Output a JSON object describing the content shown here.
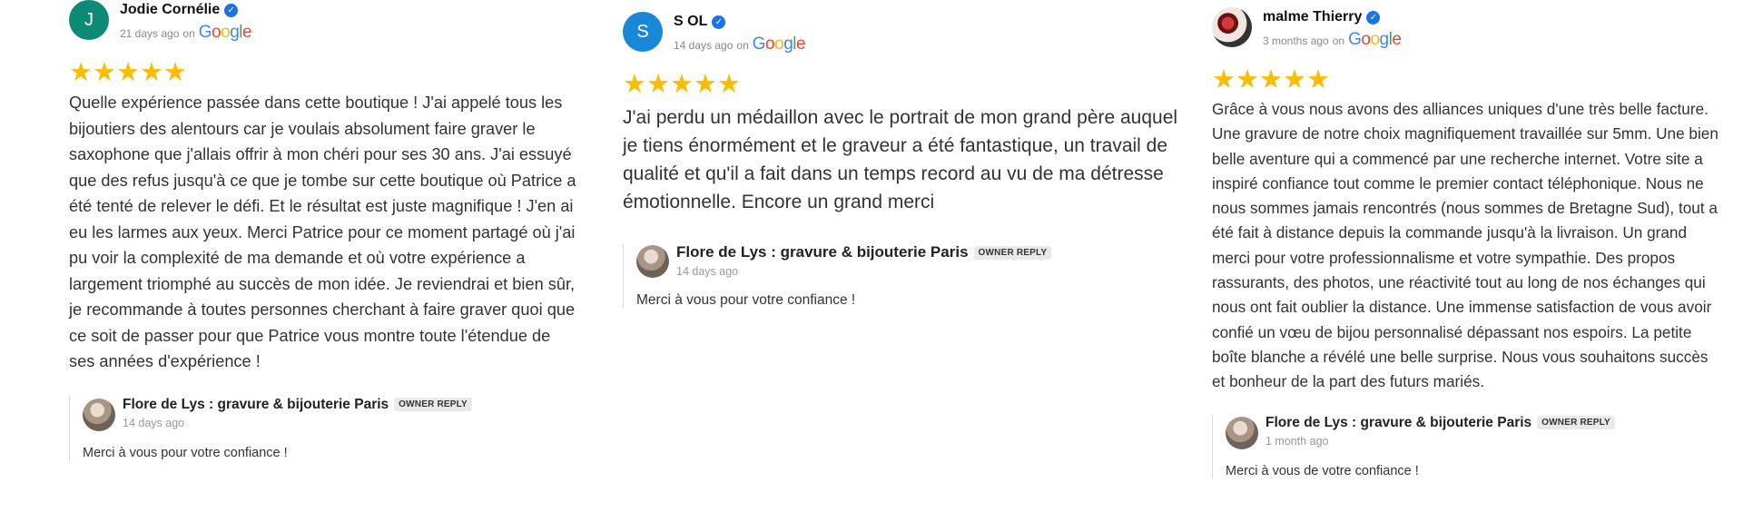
{
  "reviews": [
    {
      "avatar_letter": "J",
      "author": "Jodie Cornélie",
      "time": "21 days ago",
      "source_prefix": "on",
      "stars": "★★★★★",
      "text": "Quelle expérience passée dans cette boutique ! J'ai appelé tous les bijoutiers des alentours car je voulais absolument faire graver le saxophone que j'allais offrir à mon chéri pour ses 30 ans. J'ai essuyé que des refus jusqu'à ce que je tombe sur cette boutique où Patrice a été tenté de relever le défi. Et le résultat est juste magnifique ! J'en ai eu les larmes aux yeux. Merci Patrice pour ce moment partagé où j'ai pu voir la complexité de ma demande et où votre expérience a largement triomphé au succès de mon idée. Je reviendrai et bien sûr, je recommande à toutes personnes cherchant à faire graver quoi que ce soit de passer pour que Patrice vous montre toute l'étendue de ses années d'expérience !",
      "reply": {
        "owner": "Flore de Lys : gravure & bijouterie Paris",
        "badge": "OWNER REPLY",
        "time": "14 days ago",
        "text": "Merci à vous pour votre confiance !"
      }
    },
    {
      "avatar_letter": "S",
      "author": "S OL",
      "time": "14 days ago",
      "source_prefix": "on",
      "stars": "★★★★★",
      "text": "J'ai perdu un médaillon avec le portrait de mon grand père auquel je tiens énormément et le graveur a été fantastique, un travail de qualité et qu'il a fait dans un temps record au vu de ma détresse émotionnelle. Encore un grand merci",
      "reply": {
        "owner": "Flore de Lys : gravure & bijouterie Paris",
        "badge": "OWNER REPLY",
        "time": "14 days ago",
        "text": "Merci à vous pour votre confiance !"
      }
    },
    {
      "avatar_letter": "",
      "author": "malme Thierry",
      "time": "3 months ago",
      "source_prefix": "on",
      "stars": "★★★★★",
      "text": "Grâce à vous nous avons des alliances uniques d'une très belle facture. Une gravure de notre choix magnifiquement travaillée sur 5mm. Une bien belle aventure qui a commencé par une recherche internet. Votre site a inspiré confiance tout comme le premier contact téléphonique. Nous ne nous sommes jamais rencontrés (nous sommes de Bretagne Sud), tout a été fait à distance depuis la commande jusqu'à la livraison. Un grand merci pour votre professionnalisme et votre sympathie. Des propos rassurants, des photos, une réactivité tout au long de nos échanges qui nous ont fait oublier la distance. Une immense satisfaction de vous avoir confié un vœu de bijou personnalisé dépassant nos espoirs. La petite boîte blanche a révélé une belle surprise. Nous vous souhaitons succès et bonheur de la part des futurs mariés.",
      "reply": {
        "owner": "Flore de Lys : gravure & bijouterie Paris",
        "badge": "OWNER REPLY",
        "time": "1 month ago",
        "text": "Merci à vous de votre confiance !"
      }
    }
  ],
  "google_logo_letters": [
    "G",
    "o",
    "o",
    "g",
    "l",
    "e"
  ],
  "icons": {
    "verified": "verified-check-icon",
    "star": "star-icon"
  },
  "colors": {
    "star": "#fbbc04",
    "verified": "#1a73e8",
    "avatar_j": "#0b8b76",
    "avatar_s": "#1a88d8"
  }
}
